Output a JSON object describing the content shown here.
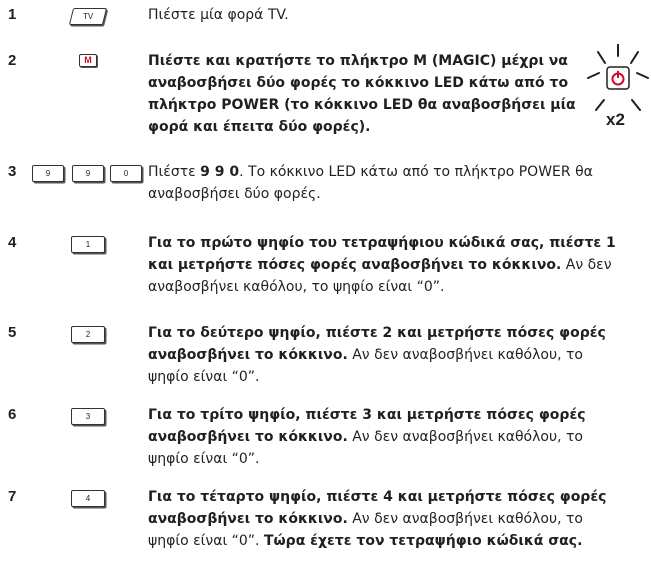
{
  "steps": [
    {
      "number": "1",
      "keys": [
        "TV"
      ],
      "parts": [
        {
          "t": "Πιέστε μία φορά TV.",
          "b": false
        }
      ]
    },
    {
      "number": "2",
      "keys": [
        "M"
      ],
      "parts": [
        {
          "t": "Πιέστε και κρατήστε το πλήκτρο M (MAGIC) μέχρι να αναβοσβήσει δύο φορές το κόκκινο LED κάτω από το πλήκτρο POWER (το κόκκινο LED θα αναβοσβήσει μία φορά και έπειτα δύο φορές).",
          "b": true
        }
      ],
      "badge": "x2"
    },
    {
      "number": "3",
      "keys": [
        "9",
        "9",
        "0"
      ],
      "parts": [
        {
          "t": "Πιέστε ",
          "b": false
        },
        {
          "t": "9 9 0",
          "b": true
        },
        {
          "t": ". Το κόκκινο LED κάτω από το πλήκτρο POWER θα αναβοσβήσει δύο φορές.",
          "b": false
        }
      ]
    },
    {
      "number": "4",
      "keys": [
        "1"
      ],
      "parts": [
        {
          "t": "Για το πρώτο ψηφίο του τετραψήφιου κώδικά σας, πιέστε 1 και μετρήστε πόσες φορές αναβοσβήνει το κόκκινο.",
          "b": true
        },
        {
          "t": " Αν δεν αναβοσβήνει καθόλου, το ψηφίο είναι “0”.",
          "b": false
        }
      ]
    },
    {
      "number": "5",
      "keys": [
        "2"
      ],
      "parts": [
        {
          "t": "Για το δεύτερο ψηφίο, πιέστε 2 και μετρήστε πόσες φορές αναβοσβήνει το κόκκινο.",
          "b": true
        },
        {
          "t": " Αν δεν αναβοσβήνει καθόλου, το ψηφίο είναι “0”.",
          "b": false
        }
      ]
    },
    {
      "number": "6",
      "keys": [
        "3"
      ],
      "parts": [
        {
          "t": "Για το τρίτο ψηφίο, πιέστε 3 και μετρήστε πόσες φορές αναβοσβήνει το κόκκινο.",
          "b": true
        },
        {
          "t": " Αν δεν αναβοσβήνει καθόλου, το ψηφίο είναι “0”.",
          "b": false
        }
      ]
    },
    {
      "number": "7",
      "keys": [
        "4"
      ],
      "parts": [
        {
          "t": "Για το τέταρτο ψηφίο, πιέστε 4 και μετρήστε πόσες φορές αναβοσβήνει το κόκκινο.",
          "b": true
        },
        {
          "t": " Αν δεν αναβοσβήνει καθόλου, το ψηφίο είναι “0”. ",
          "b": false
        },
        {
          "t": "Τώρα έχετε τον τετραψήφιο κώδικά σας.",
          "b": true
        }
      ]
    }
  ],
  "colors": {
    "accent": "#c8102e",
    "text": "#231f20"
  },
  "icons": {
    "power": "power-icon"
  }
}
